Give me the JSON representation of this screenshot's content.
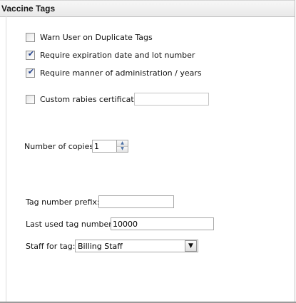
{
  "panel": {
    "title": "Vaccine Tags"
  },
  "options": [
    {
      "label": "Warn User on Duplicate Tags",
      "checked": false
    },
    {
      "label": "Require expiration date and lot number",
      "checked": true
    },
    {
      "label": "Require manner of administration / years",
      "checked": true
    }
  ],
  "rabies": {
    "label": "Custom rabies certificate",
    "checked": false,
    "value": ""
  },
  "copies": {
    "label": "Number of copies:",
    "value": "1"
  },
  "tag_prefix": {
    "label": "Tag number prefix:",
    "value": ""
  },
  "last_tag": {
    "label": "Last used tag number:",
    "value": "10000"
  },
  "staff": {
    "label": "Staff for tag:",
    "value": "Billing Staff"
  },
  "icons": {
    "check": "checkmark-icon",
    "spin_up": "spin-up-icon",
    "spin_down": "spin-down-icon",
    "dropdown": "chevron-down-icon"
  },
  "colors": {
    "check": "#1f3f8c",
    "spin_arrow": "#4a6fa5"
  }
}
